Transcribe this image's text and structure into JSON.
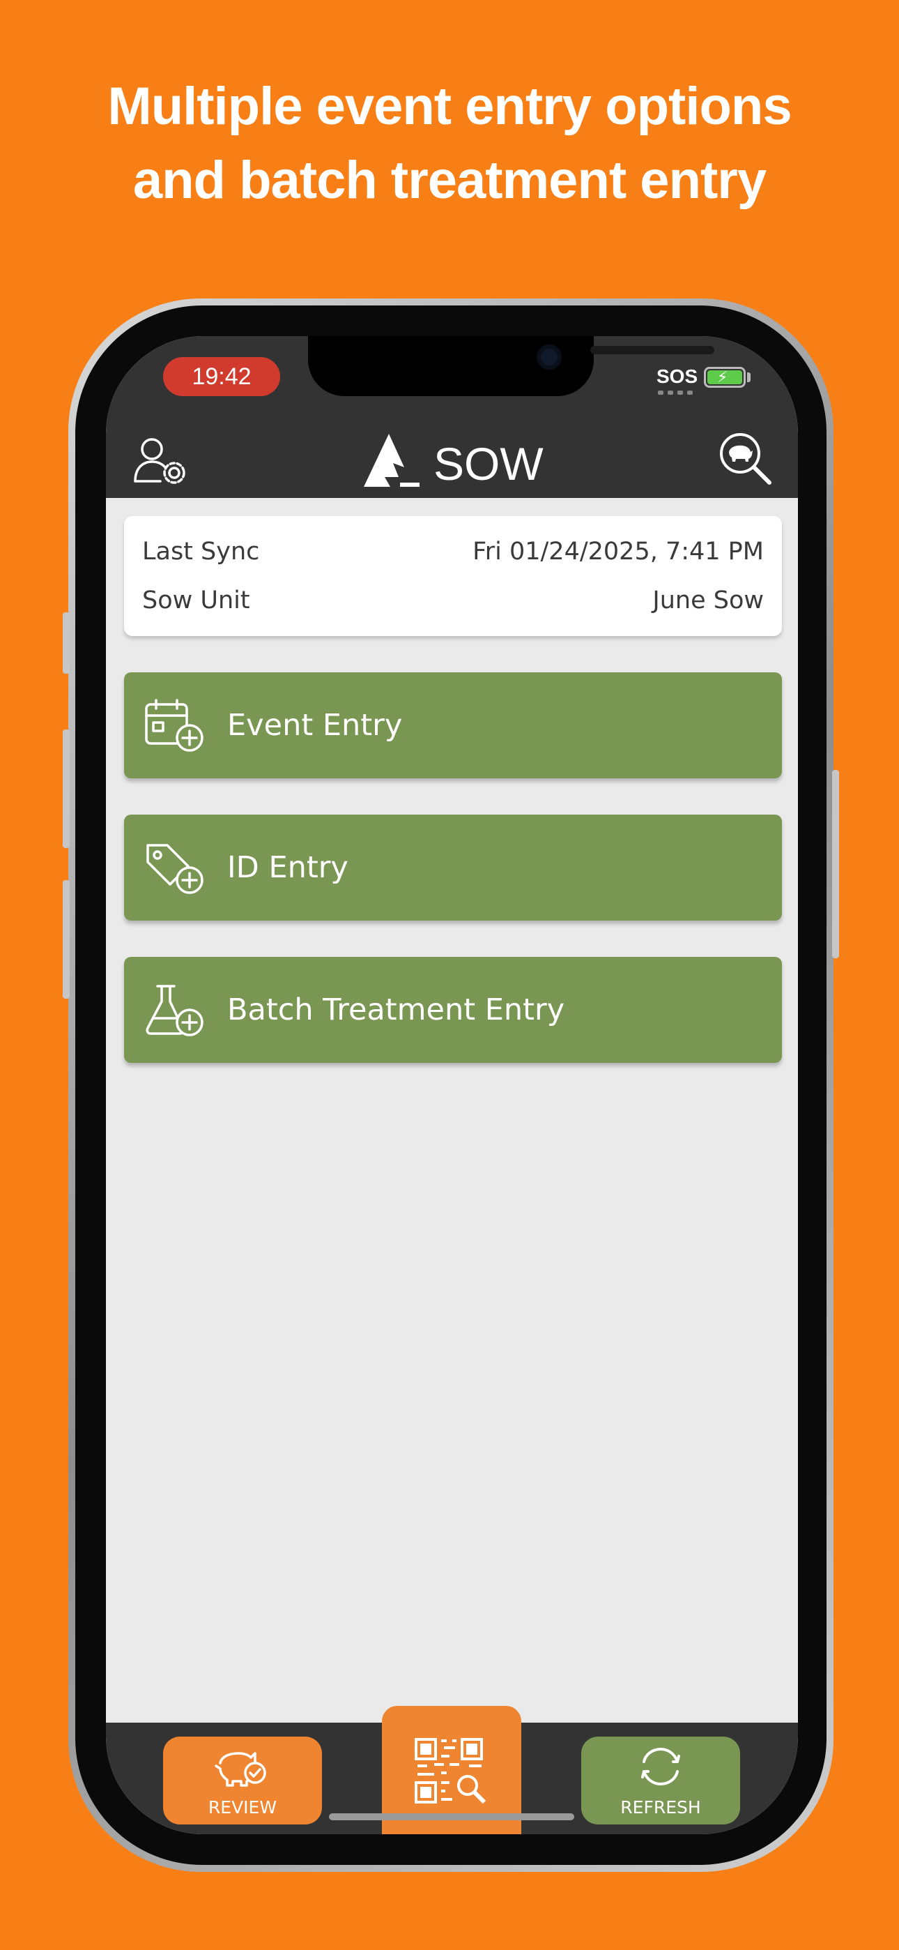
{
  "headline": {
    "line1": "Multiple event entry options",
    "line2": "and batch treatment entry"
  },
  "status_bar": {
    "time": "19:42",
    "sos": "SOS"
  },
  "header": {
    "logo_text": "SOW"
  },
  "sync_card": {
    "last_sync_label": "Last Sync",
    "last_sync_value": "Fri 01/24/2025, 7:41 PM",
    "unit_label": "Sow Unit",
    "unit_value": "June Sow"
  },
  "entries": [
    {
      "label": "Event Entry",
      "icon": "calendar-plus-icon"
    },
    {
      "label": "ID Entry",
      "icon": "tag-plus-icon"
    },
    {
      "label": "Batch Treatment Entry",
      "icon": "flask-plus-icon"
    }
  ],
  "bottom_nav": {
    "review_label": "REVIEW",
    "refresh_label": "REFRESH",
    "scan_icon": "qr-search-icon"
  },
  "colors": {
    "background": "#F77F15",
    "header": "#333333",
    "entry_button": "#7A9653",
    "review_button": "#EF8531",
    "refresh_button": "#7A9653",
    "time_pill": "#D13B2E",
    "screen_bg": "#EAEAEA"
  }
}
